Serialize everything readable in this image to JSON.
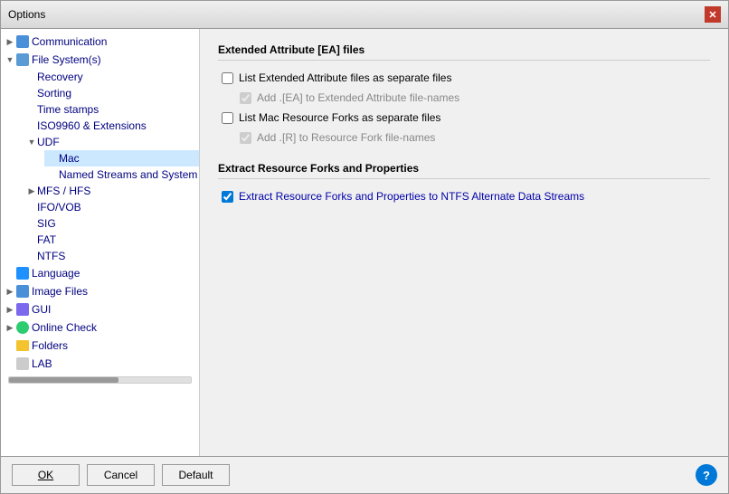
{
  "dialog": {
    "title": "Options",
    "close_label": "✕"
  },
  "tree": {
    "items": [
      {
        "id": "communication",
        "label": "Communication",
        "level": 0,
        "icon": "comm",
        "expanded": false,
        "has_arrow": true
      },
      {
        "id": "filesystem",
        "label": "File System(s)",
        "level": 0,
        "icon": "fs",
        "expanded": true,
        "has_arrow": true
      },
      {
        "id": "recovery",
        "label": "Recovery",
        "level": 1,
        "icon": "none",
        "expanded": false,
        "has_arrow": false
      },
      {
        "id": "sorting",
        "label": "Sorting",
        "level": 1,
        "icon": "none",
        "expanded": false,
        "has_arrow": false
      },
      {
        "id": "timestamps",
        "label": "Time stamps",
        "level": 1,
        "icon": "none",
        "expanded": false,
        "has_arrow": false
      },
      {
        "id": "iso9960",
        "label": "ISO9960 & Extensions",
        "level": 1,
        "icon": "none",
        "expanded": false,
        "has_arrow": false
      },
      {
        "id": "udf",
        "label": "UDF",
        "level": 1,
        "icon": "none",
        "expanded": true,
        "has_arrow": true
      },
      {
        "id": "mac",
        "label": "Mac",
        "level": 2,
        "icon": "none",
        "expanded": false,
        "has_arrow": false,
        "selected": true
      },
      {
        "id": "namedstreams",
        "label": "Named Streams and System",
        "level": 2,
        "icon": "none",
        "expanded": false,
        "has_arrow": false
      },
      {
        "id": "mfshfs",
        "label": "MFS / HFS",
        "level": 1,
        "icon": "none",
        "expanded": false,
        "has_arrow": true
      },
      {
        "id": "ifovob",
        "label": "IFO/VOB",
        "level": 1,
        "icon": "none",
        "expanded": false,
        "has_arrow": false
      },
      {
        "id": "sig",
        "label": "SIG",
        "level": 1,
        "icon": "none",
        "expanded": false,
        "has_arrow": false
      },
      {
        "id": "fat",
        "label": "FAT",
        "level": 1,
        "icon": "none",
        "expanded": false,
        "has_arrow": false
      },
      {
        "id": "ntfs",
        "label": "NTFS",
        "level": 1,
        "icon": "none",
        "expanded": false,
        "has_arrow": false
      },
      {
        "id": "language",
        "label": "Language",
        "level": 0,
        "icon": "lang",
        "expanded": false,
        "has_arrow": false
      },
      {
        "id": "imagefiles",
        "label": "Image Files",
        "level": 0,
        "icon": "image",
        "expanded": false,
        "has_arrow": true
      },
      {
        "id": "gui",
        "label": "GUI",
        "level": 0,
        "icon": "gui",
        "expanded": false,
        "has_arrow": true
      },
      {
        "id": "onlinecheck",
        "label": "Online Check",
        "level": 0,
        "icon": "online",
        "expanded": false,
        "has_arrow": true
      },
      {
        "id": "folders",
        "label": "Folders",
        "level": 0,
        "icon": "folder",
        "expanded": false,
        "has_arrow": false
      },
      {
        "id": "lab",
        "label": "LAB",
        "level": 0,
        "icon": "lab",
        "expanded": false,
        "has_arrow": false
      }
    ]
  },
  "right_panel": {
    "section1": {
      "header": "Extended Attribute [EA] files",
      "options": [
        {
          "id": "list_ea",
          "label": "List Extended Attribute files as separate files",
          "checked": false,
          "disabled": false,
          "indented": false
        },
        {
          "id": "add_ea",
          "label": "Add .[EA] to Extended Attribute file-names",
          "checked": true,
          "disabled": true,
          "indented": true
        },
        {
          "id": "list_mac",
          "label": "List Mac Resource Forks as separate files",
          "checked": false,
          "disabled": false,
          "indented": false
        },
        {
          "id": "add_r",
          "label": "Add .[R] to Resource Fork file-names",
          "checked": true,
          "disabled": true,
          "indented": true
        }
      ]
    },
    "section2": {
      "header": "Extract Resource Forks and Properties",
      "options": [
        {
          "id": "extract_ntfs",
          "label": "Extract Resource Forks and Properties to NTFS Alternate Data Streams",
          "checked": true,
          "disabled": false,
          "indented": false
        }
      ]
    }
  },
  "footer": {
    "ok_label": "OK",
    "cancel_label": "Cancel",
    "default_label": "Default",
    "help_label": "?"
  }
}
